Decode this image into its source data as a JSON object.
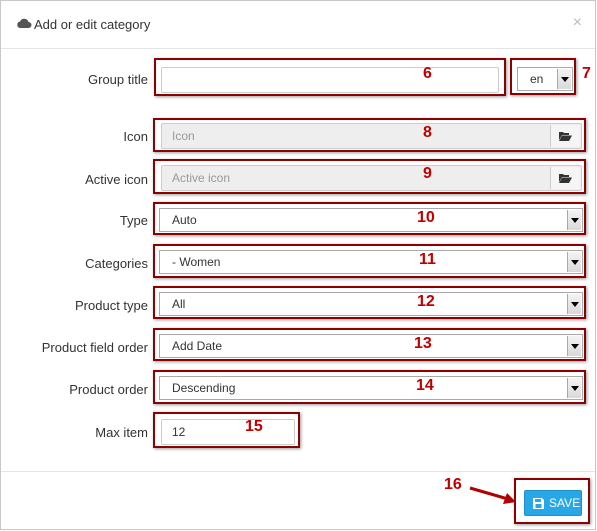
{
  "dialog": {
    "title": "Add or edit category",
    "close_glyph": "×"
  },
  "form": {
    "group_title": {
      "label": "Group title",
      "value": "",
      "language": "en"
    },
    "icon": {
      "label": "Icon",
      "placeholder": "Icon"
    },
    "active_icon": {
      "label": "Active icon",
      "placeholder": "Active icon"
    },
    "type": {
      "label": "Type",
      "value": "Auto"
    },
    "categories": {
      "label": "Categories",
      "value": "- Women"
    },
    "product_type": {
      "label": "Product type",
      "value": "All"
    },
    "product_field_order": {
      "label": "Product field order",
      "value": "Add Date"
    },
    "product_order": {
      "label": "Product order",
      "value": "Descending"
    },
    "max_item": {
      "label": "Max item",
      "value": "12"
    }
  },
  "footer": {
    "save_label": "SAVE"
  },
  "annotations": {
    "n6": "6",
    "n7": "7",
    "n8": "8",
    "n9": "9",
    "n10": "10",
    "n11": "11",
    "n12": "12",
    "n13": "13",
    "n14": "14",
    "n15": "15",
    "n16": "16"
  },
  "colors": {
    "annotation": "#8b0000",
    "save_button": "#28a7e6"
  },
  "icons": {
    "header": "cloud-icon",
    "file_browse": "folder-open-icon",
    "save": "floppy-disk-icon"
  }
}
